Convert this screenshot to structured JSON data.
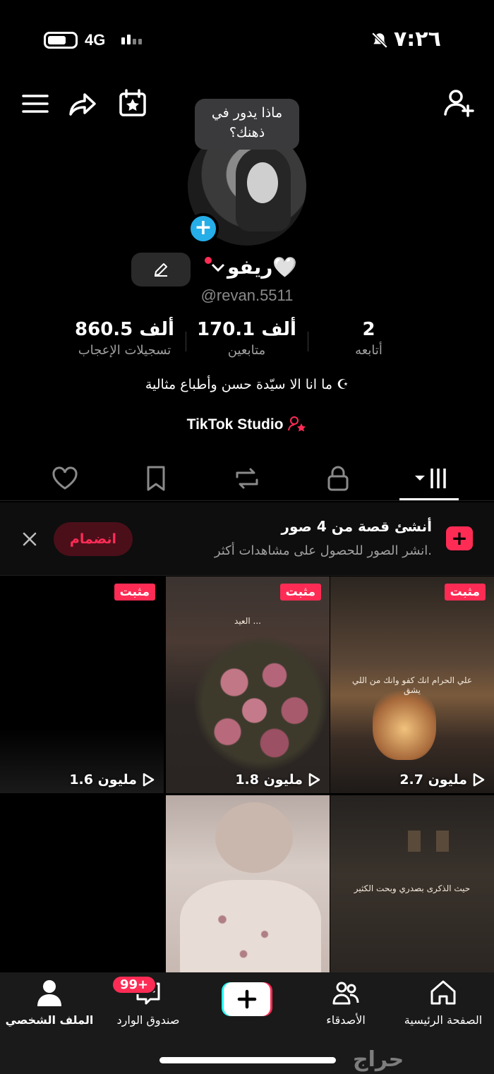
{
  "status_bar": {
    "network": "4G",
    "time": "٧:٢٦"
  },
  "profile": {
    "bubble": "ماذا يدور في ذهنك؟",
    "name": "ريفو🤍",
    "handle": "@revan.5511",
    "stats": [
      {
        "value": "2",
        "label": "أتابعه"
      },
      {
        "value": "170.1 ألف",
        "label": "متابعين"
      },
      {
        "value": "860.5 ألف",
        "label": "تسجيلات الإعجاب"
      }
    ],
    "bio": "ما انا الا سيّدة حسن وأطباع مثالية ☪︎",
    "studio_label": "TikTok Studio"
  },
  "tabs": [
    "videos",
    "private",
    "reposts",
    "saved",
    "liked"
  ],
  "banner": {
    "title": "أنشئ قصة من 4 صور",
    "subtitle": "انشر الصور للحصول على مشاهدات أكثر.",
    "join_label": "انضمام"
  },
  "videos": [
    {
      "pinned": "مثبت",
      "views": "2.7 مليون",
      "caption": "علي الحرام انك كفو وانك من اللي يشق"
    },
    {
      "pinned": "مثبت",
      "views": "1.8 مليون",
      "caption": "العيد ..."
    },
    {
      "pinned": "مثبت",
      "views": "1.6 مليون",
      "caption": ""
    },
    {
      "pinned": "",
      "views": "",
      "caption": "حيث الذكرى بصدري وبحت الكثير"
    },
    {
      "pinned": "",
      "views": "",
      "caption": ""
    },
    {
      "pinned": "",
      "views": "",
      "caption": ""
    }
  ],
  "bottom_nav": {
    "home": "الصفحة الرئيسية",
    "friends": "الأصدقاء",
    "inbox": "صندوق الوارد",
    "inbox_badge": "99+",
    "profile": "الملف الشخصي"
  },
  "watermark": "حراج",
  "colors": {
    "accent": "#fe2c55",
    "add_blue": "#25aee8"
  }
}
